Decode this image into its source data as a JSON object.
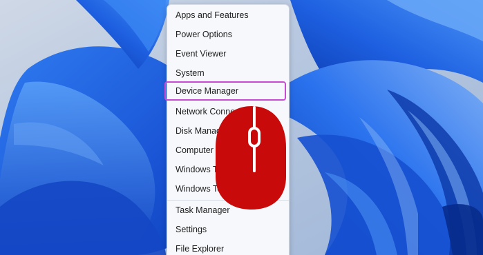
{
  "quick_link_menu": {
    "items": [
      {
        "label": "Apps and Features",
        "name": "menu-item-apps-and-features"
      },
      {
        "label": "Power Options",
        "name": "menu-item-power-options"
      },
      {
        "label": "Event Viewer",
        "name": "menu-item-event-viewer"
      },
      {
        "label": "System",
        "name": "menu-item-system"
      },
      {
        "label": "Device Manager",
        "name": "menu-item-device-manager",
        "highlighted": true
      },
      {
        "label": "Network Connections",
        "name": "menu-item-network-connections"
      },
      {
        "label": "Disk Management",
        "name": "menu-item-disk-management"
      },
      {
        "label": "Computer Management",
        "name": "menu-item-computer-management"
      },
      {
        "label": "Windows Terminal",
        "name": "menu-item-windows-terminal"
      },
      {
        "label": "Windows Terminal (Admin)",
        "name": "menu-item-windows-terminal-admin"
      },
      {
        "label": "Task Manager",
        "name": "menu-item-task-manager"
      },
      {
        "label": "Settings",
        "name": "menu-item-settings"
      },
      {
        "label": "File Explorer",
        "name": "menu-item-file-explorer"
      }
    ]
  },
  "colors": {
    "wallpaper_dark": "#0c3fb8",
    "wallpaper_mid": "#2f6fe0",
    "wallpaper_light": "#7fb0f5",
    "menu_background": "#f6f8fb",
    "highlight_border": "#c64bd2",
    "mouse_icon": "#c90a0a"
  },
  "overlay": {
    "icon": "mouse-icon",
    "meaning": "right-click"
  }
}
